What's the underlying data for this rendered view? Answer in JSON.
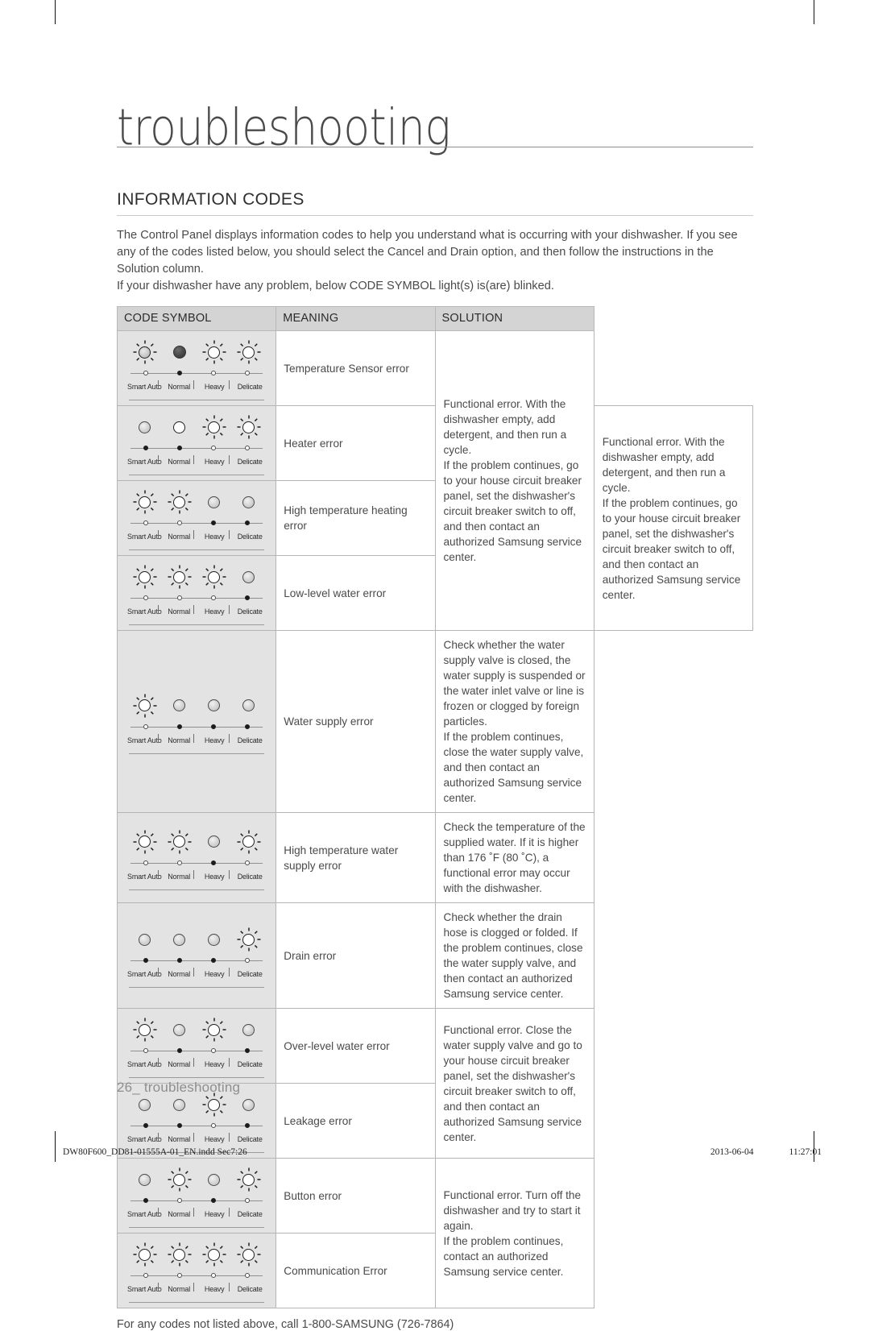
{
  "chapter": {
    "title": "troubleshooting"
  },
  "section": {
    "heading": "INFORMATION CODES"
  },
  "intro": {
    "paragraph1": "The Control Panel displays information codes to help you understand what is occurring with your dishwasher. If you see any of the codes listed below, you should select the Cancel and Drain option, and then follow the instructions in the Solution column.",
    "paragraph2": "If your dishwasher have any problem, below CODE SYMBOL light(s) is(are) blinked."
  },
  "table": {
    "headers": [
      "CODE SYMBOL",
      "MEANING",
      "SOLUTION"
    ],
    "lamp_labels": [
      "Smart Auto",
      "Normal",
      "Heavy",
      "Delicate"
    ],
    "rows": [
      {
        "meaning": "Temperature Sensor error",
        "lamps": [
          "onshade",
          "filled",
          "on",
          "on"
        ],
        "knobs": [
          "open",
          "dot",
          "open",
          "open"
        ]
      },
      {
        "meaning": "Heater error",
        "lamps": [
          "off",
          "on-plain",
          "on",
          "on"
        ],
        "knobs": [
          "dot",
          "dot",
          "open",
          "open"
        ]
      },
      {
        "meaning": "High temperature heating error",
        "lamps": [
          "on",
          "on",
          "off",
          "off"
        ],
        "knobs": [
          "open",
          "open",
          "dot",
          "dot"
        ]
      },
      {
        "meaning": "Low-level water error",
        "lamps": [
          "on",
          "on",
          "on",
          "off"
        ],
        "knobs": [
          "open",
          "open",
          "open",
          "dot"
        ]
      },
      {
        "meaning": "Water supply error",
        "lamps": [
          "on",
          "off",
          "off",
          "off"
        ],
        "knobs": [
          "open",
          "dot",
          "dot",
          "dot"
        ]
      },
      {
        "meaning": "High temperature water supply error",
        "lamps": [
          "on",
          "on",
          "off",
          "on"
        ],
        "knobs": [
          "open",
          "open",
          "dot",
          "open"
        ]
      },
      {
        "meaning": "Drain error",
        "lamps": [
          "off",
          "off",
          "off",
          "on"
        ],
        "knobs": [
          "dot",
          "dot",
          "dot",
          "open"
        ]
      },
      {
        "meaning": "Over-level water error",
        "lamps": [
          "on",
          "off",
          "on",
          "off"
        ],
        "knobs": [
          "open",
          "dot",
          "open",
          "dot"
        ]
      },
      {
        "meaning": "Leakage error",
        "lamps": [
          "off",
          "off",
          "on",
          "off"
        ],
        "knobs": [
          "dot",
          "dot",
          "open",
          "dot"
        ]
      },
      {
        "meaning": "Button error",
        "lamps": [
          "off",
          "on",
          "off",
          "on"
        ],
        "knobs": [
          "dot",
          "open",
          "dot",
          "open"
        ]
      },
      {
        "meaning": "Communication Error",
        "lamps": [
          "on",
          "on",
          "on",
          "on"
        ],
        "knobs": [
          "open",
          "open",
          "open",
          "open"
        ]
      }
    ],
    "solutions": {
      "functional_heater": "Functional error. With the dishwasher empty, add detergent, and then run a cycle.\nIf the problem continues, go to your house circuit breaker panel, set the dishwasher's circuit breaker switch to off, and then contact an authorized Samsung service center.",
      "water_supply": "Check whether the water supply valve is closed, the water supply is suspended or the water inlet valve or line is frozen or clogged by foreign particles.\nIf the problem continues, close the water supply valve, and then contact an authorized Samsung service center.",
      "high_temp_water": "Check the temperature of the supplied water. If it is higher than 176 ˚F (80 ˚C), a functional error may occur with the dishwasher.",
      "drain": "Check whether the drain hose is clogged or folded. If the problem continues, close the water supply valve, and then contact an authorized Samsung service center.",
      "over_level": "Functional error. Close the water supply valve and go to your house circuit breaker panel, set the dishwasher's circuit breaker switch to off, and then contact an authorized Samsung service center.",
      "button": "Functional error. Turn off the dishwasher and try to start it again.\nIf the problem continues, contact an authorized Samsung service center."
    }
  },
  "note": "For any codes not listed above, call 1-800-SAMSUNG (726-7864)",
  "folio": "26_ troubleshooting",
  "meta": {
    "file": "DW80F600_DD81-01555A-01_EN.indd   Sec7:26",
    "date": "2013-06-04",
    "time": "11:27:01"
  }
}
